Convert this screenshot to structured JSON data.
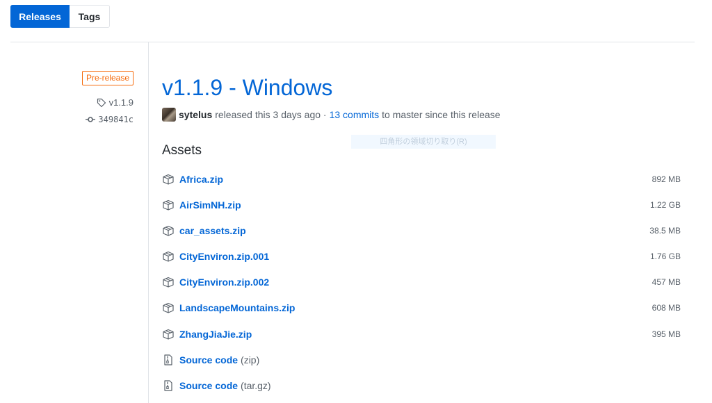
{
  "tabs": [
    {
      "label": "Releases",
      "active": true
    },
    {
      "label": "Tags",
      "active": false
    }
  ],
  "sidebar": {
    "badge": "Pre-release",
    "tag": "v1.1.9",
    "commit": "349841c"
  },
  "release": {
    "title": "v1.1.9 - Windows",
    "author": "sytelus",
    "released_text": "released this 3 days ago ·",
    "commits_link": "13 commits",
    "commits_suffix": "to master since this release"
  },
  "overlay_hint": "四角形の領域切り取り(R)",
  "assets": {
    "heading": "Assets",
    "items": [
      {
        "name": "Africa.zip",
        "size": "892 MB",
        "icon": "package-icon"
      },
      {
        "name": "AirSimNH.zip",
        "size": "1.22 GB",
        "icon": "package-icon"
      },
      {
        "name": "car_assets.zip",
        "size": "38.5 MB",
        "icon": "package-icon"
      },
      {
        "name": "CityEnviron.zip.001",
        "size": "1.76 GB",
        "icon": "package-icon"
      },
      {
        "name": "CityEnviron.zip.002",
        "size": "457 MB",
        "icon": "package-icon"
      },
      {
        "name": "LandscapeMountains.zip",
        "size": "608 MB",
        "icon": "package-icon"
      },
      {
        "name": "ZhangJiaJie.zip",
        "size": "395 MB",
        "icon": "package-icon"
      }
    ],
    "source": [
      {
        "name": "Source code",
        "suffix": "(zip)",
        "icon": "file-zip-icon"
      },
      {
        "name": "Source code",
        "suffix": "(tar.gz)",
        "icon": "file-zip-icon"
      }
    ]
  },
  "colors": {
    "accent": "#0366d6",
    "prerelease": "#f66a0a",
    "muted": "#586069"
  }
}
